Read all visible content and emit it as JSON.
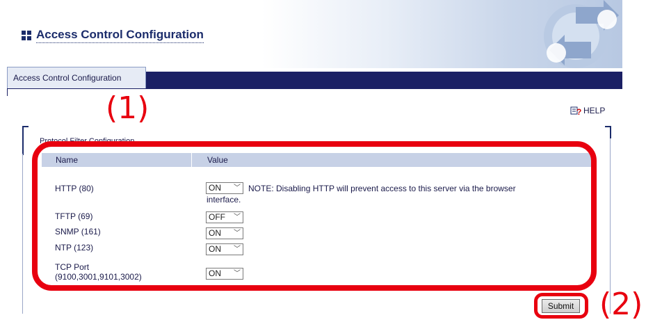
{
  "header": {
    "title": "Access Control Configuration"
  },
  "tabs": [
    {
      "label": "Access Control Configuration"
    }
  ],
  "annotations": {
    "mark1": "(1)",
    "mark2": "(2)"
  },
  "help": {
    "label": "HELP"
  },
  "section": {
    "title": "Protocol Filter Configuration"
  },
  "table": {
    "columns": [
      "Name",
      "Value"
    ],
    "rows": [
      {
        "name": "HTTP (80)",
        "value": "ON"
      },
      {
        "name": "TFTP (69)",
        "value": "OFF"
      },
      {
        "name": "SNMP (161)",
        "value": "ON"
      },
      {
        "name": "NTP (123)",
        "value": "ON"
      },
      {
        "name_line1": "TCP Port",
        "name_line2": "(9100,3001,9101,3002)",
        "value": "ON"
      }
    ],
    "note_line1": "NOTE: Disabling HTTP will prevent access to this server via the browser",
    "note_line2": "interface."
  },
  "buttons": {
    "submit": "Submit"
  },
  "colors": {
    "navy": "#1b2064",
    "accent_red": "#e8000f",
    "header_row": "#c7d1e6"
  }
}
